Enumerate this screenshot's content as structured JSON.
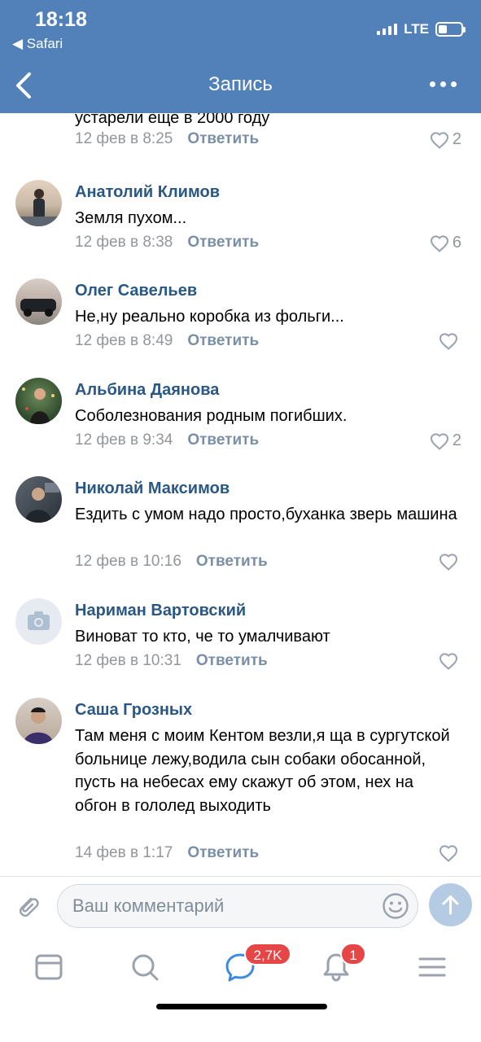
{
  "status_bar": {
    "time": "18:18",
    "back_app": "◀ Safari",
    "network": "LTE"
  },
  "nav": {
    "title": "Запись"
  },
  "comments": [
    {
      "name": "",
      "text": "устарели еще в 2000 году",
      "date": "12 фев в 8:25",
      "reply": "Ответить",
      "likes": "2"
    },
    {
      "name": "Анатолий Климов",
      "text": "Земля пухом...",
      "date": "12 фев в 8:38",
      "reply": "Ответить",
      "likes": "6"
    },
    {
      "name": "Олег Савельев",
      "text": "Не,ну реально коробка из фольги...",
      "date": "12 фев в 8:49",
      "reply": "Ответить",
      "likes": ""
    },
    {
      "name": "Альбина Даянова",
      "text": "Соболезнования родным погибших.",
      "date": "12 фев в 9:34",
      "reply": "Ответить",
      "likes": "2"
    },
    {
      "name": "Николай Максимов",
      "text": "Ездить с умом надо просто,буханка зверь машина",
      "date": "12 фев в 10:16",
      "reply": "Ответить",
      "likes": ""
    },
    {
      "name": "Нариман Вартовский",
      "text": "Виноват то кто, че то умалчивают",
      "date": "12 фев в 10:31",
      "reply": "Ответить",
      "likes": ""
    },
    {
      "name": "Саша Грозных",
      "text": "Там меня с моим Кентом везли,я ща в сургутской больнице лежу,водила сын собаки обосанной, пусть на небесах ему скажут об этом, нех на обгон в гололед выходить",
      "date": "14 фев в 1:17",
      "reply": "Ответить",
      "likes": ""
    }
  ],
  "composer": {
    "placeholder": "Ваш комментарий"
  },
  "tabbar": {
    "messages_badge": "2,7K",
    "notifications_badge": "1"
  },
  "colors": {
    "header": "#5181b8",
    "name_link": "#2a5885",
    "badge": "#e64646"
  }
}
